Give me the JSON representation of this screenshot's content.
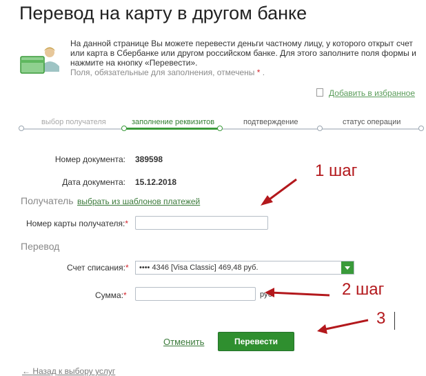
{
  "page": {
    "title": "Перевод на карту в другом банке",
    "intro_text": "На данной странице Вы можете перевести деньги частному лицу, у которого открыт счет или карта в Сбербанке или другом российском банке. Для этого заполните поля формы и нажмите на кнопку «Перевести».",
    "required_hint": "Поля, обязательные для заполнения, отмечены",
    "required_mark": "*",
    "required_end": ".",
    "favorites_link": "Добавить в избранное"
  },
  "steps": [
    {
      "label": "выбор получателя",
      "state": "done"
    },
    {
      "label": "заполнение реквизитов",
      "state": "current"
    },
    {
      "label": "подтверждение",
      "state": "pending"
    },
    {
      "label": "статус операции",
      "state": "pending"
    }
  ],
  "document": {
    "number_label": "Номер документа:",
    "number_value": "389598",
    "date_label": "Дата документа:",
    "date_value": "15.12.2018"
  },
  "recipient": {
    "section_title": "Получатель",
    "templates_link": "выбрать из шаблонов платежей",
    "card_label": "Номер карты получателя:",
    "card_value": "",
    "required_mark": "*"
  },
  "transfer": {
    "section_title": "Перевод",
    "account_label": "Счет списания:",
    "account_selected": "•••• 4346  [Visa Classic] 469,48  руб.",
    "amount_label": "Сумма:",
    "amount_value": "",
    "currency": "руб."
  },
  "actions": {
    "cancel_label": "Отменить",
    "submit_label": "Перевести",
    "back_label": "Назад к выбору услуг",
    "back_arrow": "←"
  },
  "annotations": {
    "step1": "1 шаг",
    "step2": "2 шаг",
    "step3": "3",
    "color": "#b3181c"
  },
  "colors": {
    "accent_green": "#2f8f2f",
    "required_red": "#d2232a"
  }
}
